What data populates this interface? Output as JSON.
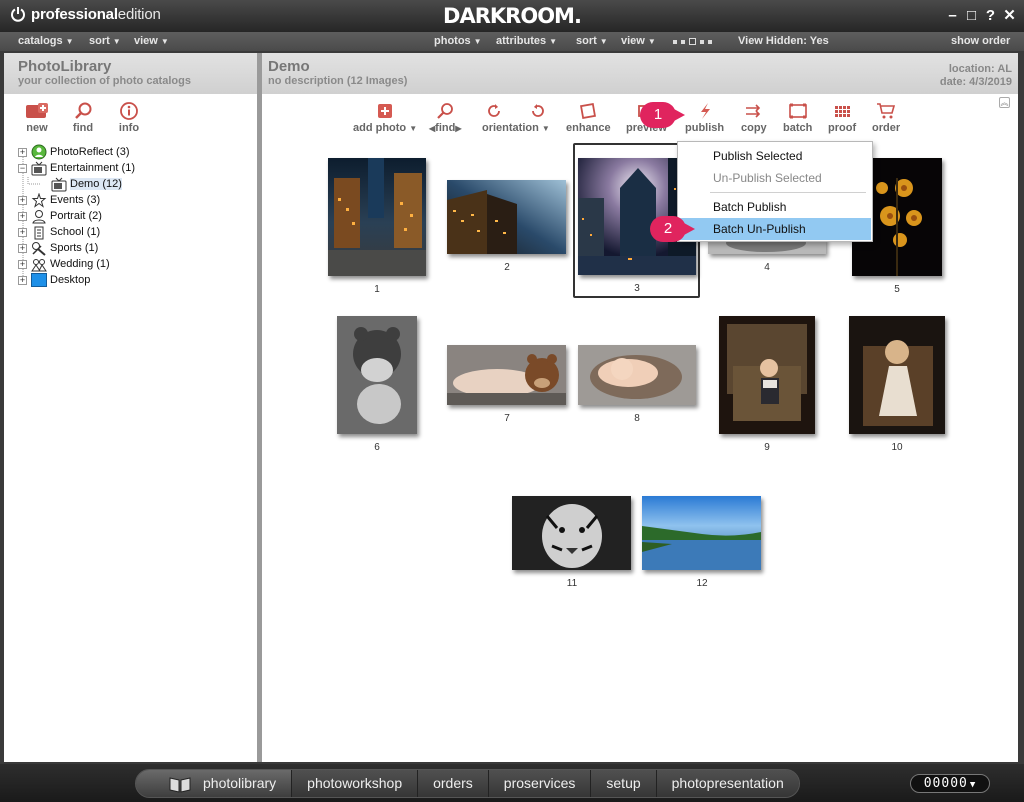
{
  "window": {
    "brand_bold": "professional",
    "brand_light": "edition",
    "logo": "DARKROOM.",
    "controls": [
      "–",
      "□",
      "?",
      "✕"
    ]
  },
  "menubar": {
    "left": [
      {
        "label": "catalogs"
      },
      {
        "label": "sort"
      },
      {
        "label": "view"
      }
    ],
    "right": [
      {
        "label": "photos"
      },
      {
        "label": "attributes"
      },
      {
        "label": "sort"
      },
      {
        "label": "view"
      }
    ],
    "view_hidden": "View Hidden: Yes",
    "show_order": "show order"
  },
  "library": {
    "title": "PhotoLibrary",
    "subtitle": "your collection of photo catalogs",
    "tools": [
      {
        "label": "new",
        "icon": "new-catalog-icon"
      },
      {
        "label": "find",
        "icon": "magnifier-icon"
      },
      {
        "label": "info",
        "icon": "info-icon"
      }
    ],
    "tree": [
      {
        "label": "PhotoReflect (3)",
        "icon": "photoreflect-icon",
        "expanded": false
      },
      {
        "label": "Entertainment (1)",
        "icon": "tv-icon",
        "expanded": true
      },
      {
        "label": "Demo (12)",
        "icon": "tv-icon",
        "child": true,
        "selected": true
      },
      {
        "label": "Events (3)",
        "icon": "events-icon",
        "expanded": false
      },
      {
        "label": "Portrait (2)",
        "icon": "portrait-icon",
        "expanded": false
      },
      {
        "label": "School (1)",
        "icon": "school-icon",
        "expanded": false
      },
      {
        "label": "Sports (1)",
        "icon": "sports-icon",
        "expanded": false
      },
      {
        "label": "Wedding (1)",
        "icon": "wedding-icon",
        "expanded": false
      },
      {
        "label": "Desktop",
        "icon": "desktop-icon",
        "expanded": false
      }
    ]
  },
  "catalog": {
    "title": "Demo",
    "description": "no description (12 Images)",
    "location": "location: AL",
    "date": "date: 4/3/2019",
    "toolbar": {
      "add_photo": "add photo",
      "find": "find",
      "orientation": "orientation",
      "enhance": "enhance",
      "preview": "preview",
      "publish": "publish",
      "copy": "copy",
      "batch": "batch",
      "proof": "proof",
      "order": "order"
    },
    "photos": [
      "1",
      "2",
      "3",
      "4",
      "5",
      "6",
      "7",
      "8",
      "9",
      "10",
      "11",
      "12"
    ]
  },
  "publish_menu": {
    "items": [
      "Publish Selected",
      "Un-Publish Selected",
      "Batch Publish",
      "Batch Un-Publish"
    ],
    "highlighted": "Batch Un-Publish"
  },
  "callouts": [
    "1",
    "2"
  ],
  "bottom_tabs": [
    "photolibrary",
    "photoworkshop",
    "orders",
    "proservices",
    "setup",
    "photopresentation"
  ],
  "counter": "00000",
  "colors": {
    "accent_pink": "#e0245e",
    "highlight_blue": "#92c9f2",
    "icon_red": "#c9504a"
  }
}
